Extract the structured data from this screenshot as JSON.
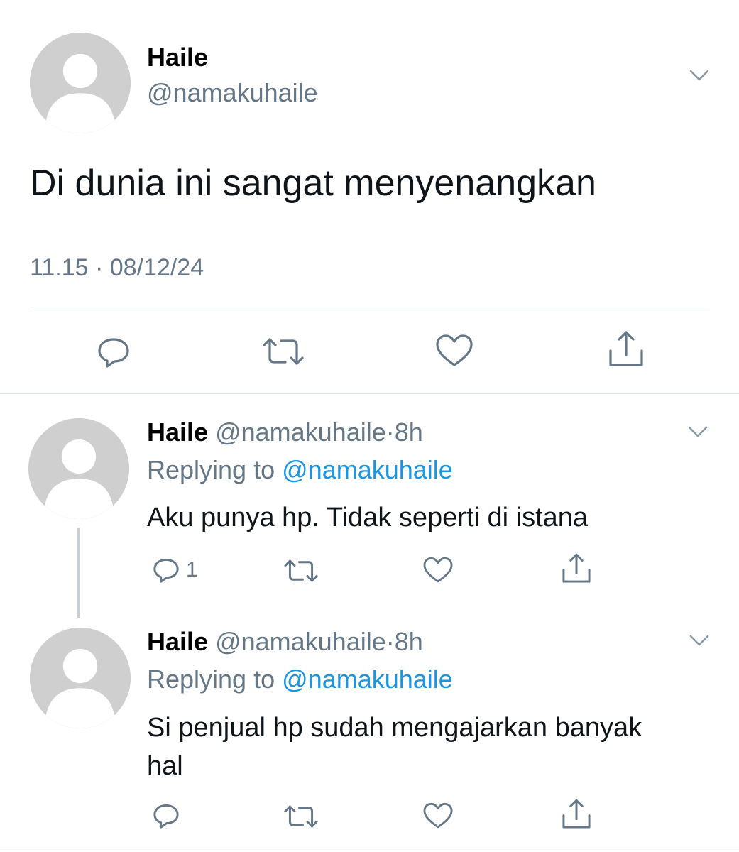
{
  "main_tweet": {
    "display_name": "Haile",
    "handle": "@namakuhaile",
    "text": "Di dunia ini sangat menyenangkan",
    "timestamp": "11.15 · 08/12/24",
    "actions": [
      "reply-icon",
      "retweet-icon",
      "like-icon",
      "share-icon"
    ]
  },
  "replies": [
    {
      "display_name": "Haile",
      "handle": "@namakuhaile",
      "separator": "·",
      "time": "8h",
      "replying_label": "Replying to",
      "replying_handle": "@namakuhaile",
      "text": "Aku punya hp. Tidak seperti di istana",
      "reply_count": "1"
    },
    {
      "display_name": "Haile",
      "handle": "@namakuhaile",
      "separator": "·",
      "time": "8h",
      "replying_label": "Replying to",
      "replying_handle": "@namakuhaile",
      "text_line1": "Si penjual hp sudah mengajarkan banyak",
      "text_line2": "hal",
      "reply_count": ""
    }
  ],
  "colors": {
    "text": "#0f1419",
    "muted": "#657786",
    "link": "#1b95e0",
    "divider": "#e1e8ed",
    "avatar_bg": "#cfcfcf"
  }
}
